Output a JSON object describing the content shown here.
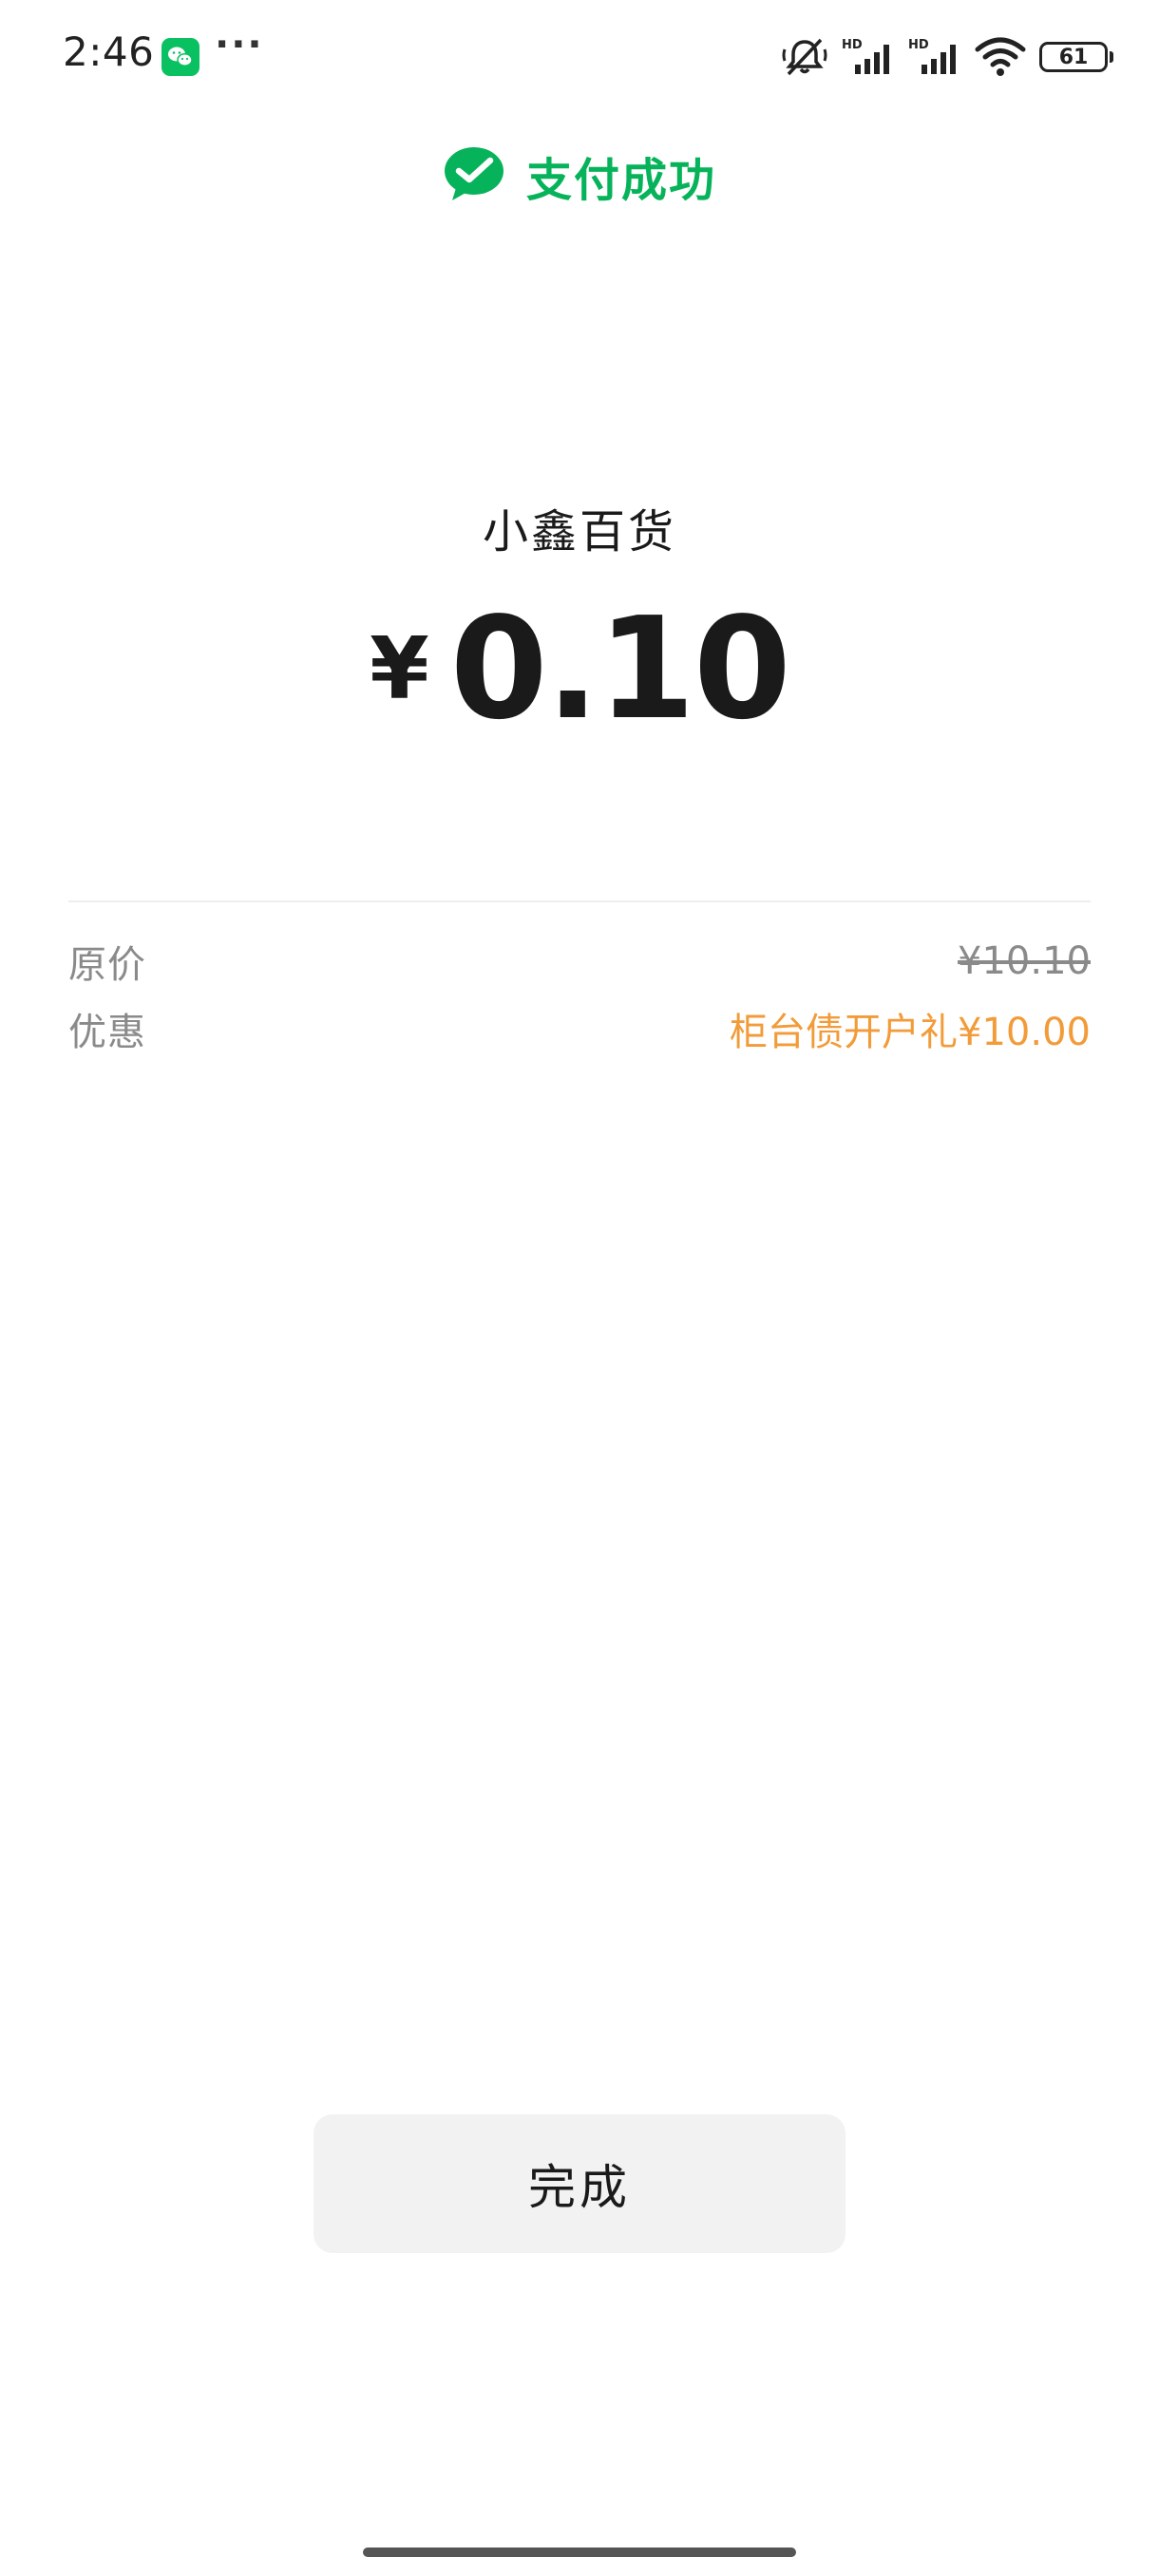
{
  "status_bar": {
    "time": "2:46",
    "more_indicator": "···",
    "battery_level": "61",
    "icons": [
      "wechat-notification-icon",
      "mute-icon",
      "hd-signal-icon",
      "hd-signal-icon",
      "wifi-icon",
      "battery-icon"
    ]
  },
  "header": {
    "title": "支付成功",
    "icon": "wechat-pay-check-icon",
    "accent_color": "#07b35a"
  },
  "payment": {
    "merchant": "小鑫百货",
    "currency_symbol": "¥",
    "amount": "0.10"
  },
  "details": {
    "rows": [
      {
        "label": "原价",
        "value": "¥10.10",
        "style": "strikethrough"
      },
      {
        "label": "优惠",
        "value": "柜台债开户礼¥10.00",
        "style": "discount"
      }
    ],
    "discount_color": "#f29b38"
  },
  "actions": {
    "done_label": "完成"
  }
}
